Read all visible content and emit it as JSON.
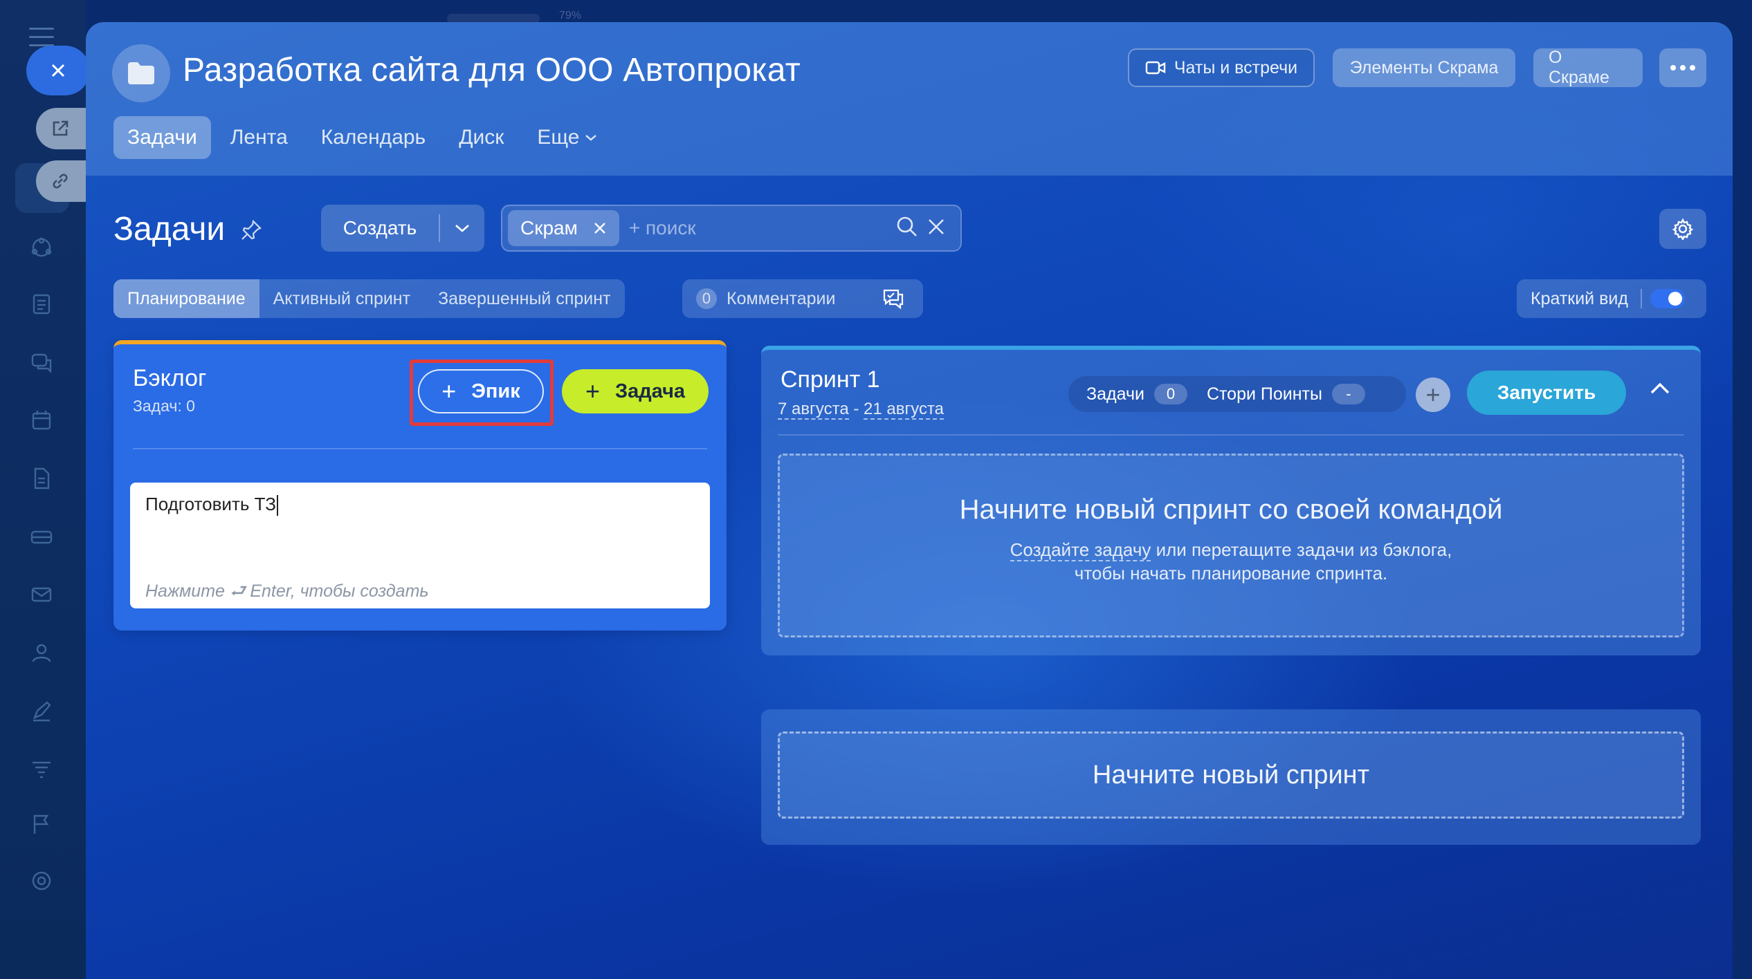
{
  "app": {
    "zoom_label": "79%"
  },
  "header": {
    "title": "Разработка сайта для ООО Автопрокат",
    "chats_button": "Чаты и встречи",
    "scrum_elements_button": "Элементы Скрама",
    "about_scrum_button": "О Скраме"
  },
  "nav": {
    "tabs": [
      {
        "label": "Задачи",
        "active": true
      },
      {
        "label": "Лента"
      },
      {
        "label": "Календарь"
      },
      {
        "label": "Диск"
      },
      {
        "label": "Еще"
      }
    ]
  },
  "toolbar": {
    "section_title": "Задачи",
    "create_label": "Создать",
    "filter_chip": "Скрам",
    "search_placeholder": "+ поиск"
  },
  "views": {
    "tabs": [
      {
        "label": "Планирование",
        "active": true
      },
      {
        "label": "Активный спринт"
      },
      {
        "label": "Завершенный спринт"
      }
    ],
    "comments_count": "0",
    "comments_label": "Комментарии",
    "brief_view_label": "Краткий вид",
    "brief_view_on": true
  },
  "backlog": {
    "title": "Бэклог",
    "count_label": "Задач: 0",
    "epic_button": "Эпик",
    "task_button": "Задача",
    "input_value": "Подготовить ТЗ",
    "input_hint": "Нажмите ⮐ Enter, чтобы создать"
  },
  "sprint": {
    "title": "Спринт 1",
    "date_start": "7 августа",
    "date_sep": " - ",
    "date_end": "21 августа",
    "tasks_label": "Задачи",
    "tasks_count": "0",
    "story_points_label": "Стори Поинты",
    "story_points_value": "-",
    "start_button": "Запустить",
    "empty_title": "Начните новый спринт со своей командой",
    "empty_link": "Создайте задачу",
    "empty_text_1": " или перетащите задачи из бэклога,",
    "empty_text_2": "чтобы начать планирование спринта."
  },
  "new_sprint": {
    "label": "Начните новый спринт"
  },
  "colors": {
    "accent_blue": "#2a6be6",
    "task_green": "#c6ec2a",
    "start_cyan": "#2aa6d8",
    "backlog_border": "#f5a623",
    "highlight_red": "#e23b3b"
  }
}
